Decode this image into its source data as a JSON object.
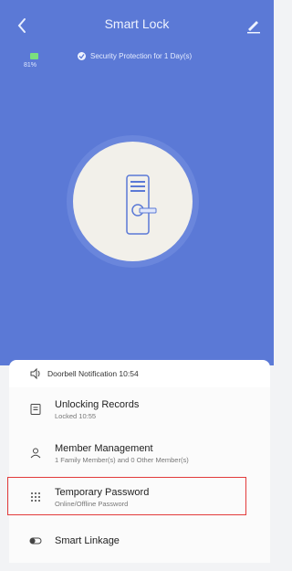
{
  "header": {
    "title": "Smart Lock"
  },
  "status": {
    "battery_percent": "81%",
    "security_text": "Security Protection for 1 Day(s)"
  },
  "notification": {
    "text": "Doorbell Notification 10:54"
  },
  "menu": [
    {
      "label": "Unlocking Records",
      "sub": "Locked 10:55",
      "icon": "document-icon"
    },
    {
      "label": "Member Management",
      "sub": "1 Family Member(s) and 0 Other Member(s)",
      "icon": "members-icon"
    },
    {
      "label": "Temporary Password",
      "sub": "Online/Offline Password",
      "icon": "keypad-icon"
    },
    {
      "label": "Smart Linkage",
      "sub": "",
      "icon": "toggle-icon"
    }
  ],
  "colors": {
    "primary": "#5b79d6",
    "highlight": "#e23b3b"
  }
}
